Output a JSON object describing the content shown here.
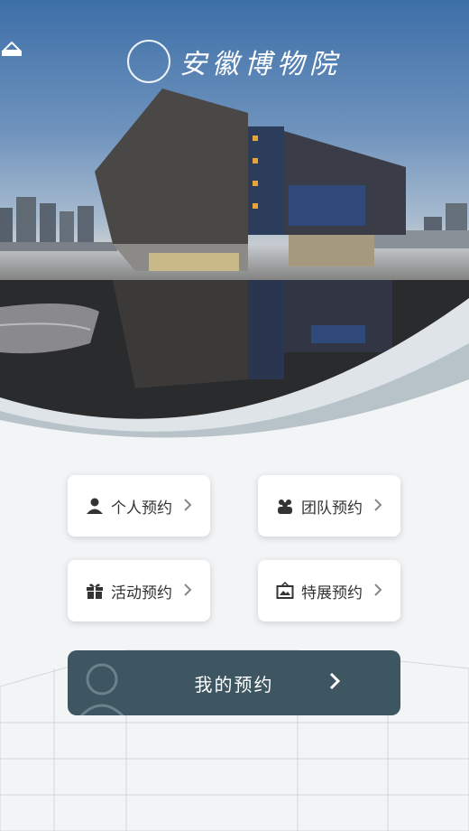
{
  "header": {
    "logo_text": "安徽博物院"
  },
  "buttons": {
    "personal": "个人预约",
    "team": "团队预约",
    "activity": "活动预约",
    "exhibition": "特展预约"
  },
  "my_reservation": {
    "label": "我的预约"
  },
  "icons": {
    "personal": "person-icon",
    "team": "group-icon",
    "activity": "gift-icon",
    "exhibition": "picture-frame-icon",
    "chevron": "chevron-right-icon"
  }
}
